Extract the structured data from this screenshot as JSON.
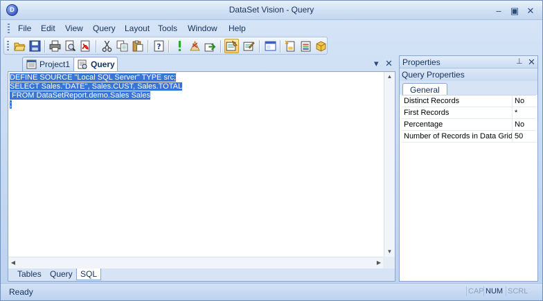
{
  "window": {
    "title": "DataSet Vision - Query"
  },
  "menu": [
    "File",
    "Edit",
    "View",
    "Query",
    "Layout",
    "Tools",
    "Window",
    "Help"
  ],
  "toolbar": {
    "icons": [
      "open-icon",
      "save-icon",
      "print-icon",
      "print-preview-icon",
      "pdf-icon",
      "cut-icon",
      "copy-icon",
      "paste-icon",
      "help-icon",
      "run-icon",
      "stop-icon",
      "export-icon",
      "query-design-icon",
      "query-edit-icon",
      "view-icon",
      "new-report-icon",
      "report-wizard-icon",
      "dataset-icon"
    ]
  },
  "doc_tabs": [
    {
      "label": "Project1",
      "active": false
    },
    {
      "label": "Query",
      "active": true
    }
  ],
  "editor": {
    "lines": [
      "DEFINE SOURCE \"Local SQL Server\" TYPE src;",
      "SELECT Sales.\"DATE\", Sales.CUST, Sales.TOTAL",
      " FROM DataSetReport.demo.Sales Sales",
      ";"
    ],
    "selection_color": "#3875d7"
  },
  "bottom_tabs": [
    {
      "label": "Tables",
      "selected": false
    },
    {
      "label": "Query",
      "selected": false
    },
    {
      "label": "SQL",
      "selected": true
    }
  ],
  "properties": {
    "title": "Properties",
    "subtitle": "Query Properties",
    "tab": "General",
    "rows": [
      {
        "name": "Distinct Records",
        "value": "No"
      },
      {
        "name": "First Records",
        "value": "*"
      },
      {
        "name": "Percentage",
        "value": "No"
      },
      {
        "name": "Number of Records in Data Grid",
        "value": "50"
      }
    ]
  },
  "status": {
    "text": "Ready",
    "indicators": [
      {
        "label": "CAP",
        "on": false
      },
      {
        "label": "NUM",
        "on": true
      },
      {
        "label": "SCRL",
        "on": false
      }
    ]
  }
}
